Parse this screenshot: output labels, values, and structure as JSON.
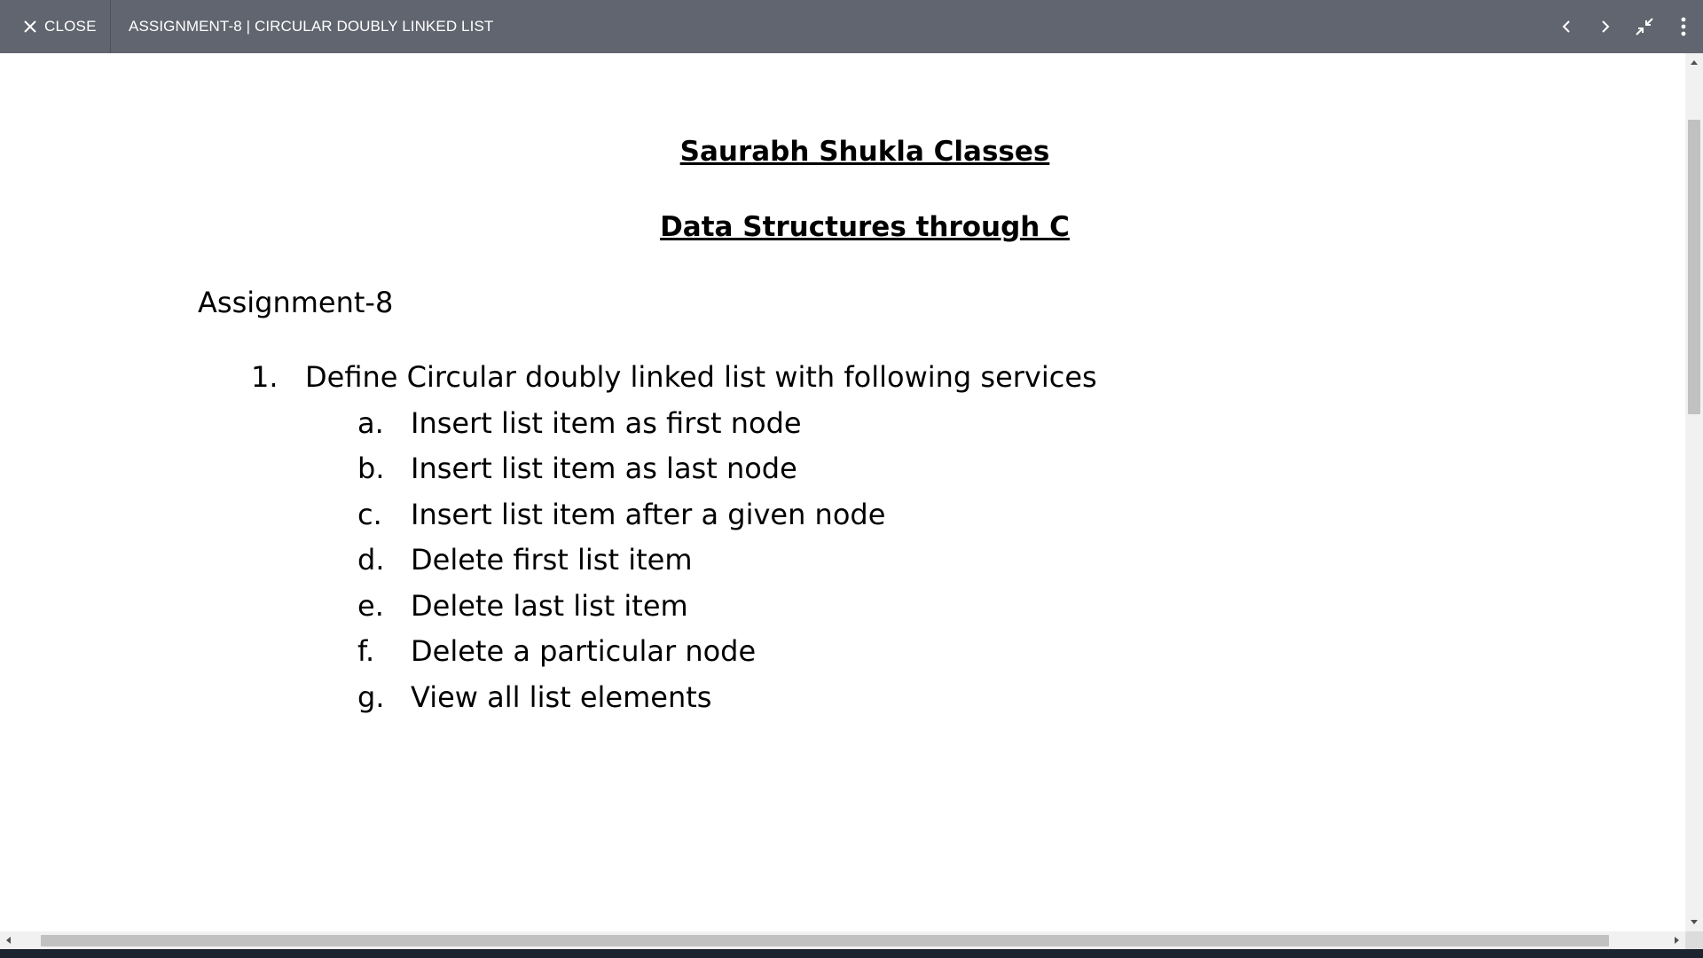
{
  "viewer": {
    "close_label": "CLOSE",
    "title": "ASSIGNMENT-8 | CIRCULAR DOUBLY LINKED LIST",
    "icons": [
      "close-icon",
      "chevron-left-icon",
      "chevron-right-icon",
      "exit-fullscreen-icon",
      "more-vertical-icon"
    ]
  },
  "document": {
    "heading1": "Saurabh Shukla Classes",
    "heading2": "Data Structures through C",
    "assignment": "Assignment-8",
    "question": {
      "number": "1.",
      "text": "Define Circular doubly linked list with following services",
      "items": [
        {
          "letter": "a.",
          "text": "Insert list item as first node"
        },
        {
          "letter": "b.",
          "text": "Insert list item as last node"
        },
        {
          "letter": "c.",
          "text": "Insert list item after a given node"
        },
        {
          "letter": "d.",
          "text": "Delete first list item"
        },
        {
          "letter": "e.",
          "text": "Delete last list item"
        },
        {
          "letter": "f.",
          "text": "Delete a particular node"
        },
        {
          "letter": "g.",
          "text": "View all list elements"
        }
      ]
    }
  },
  "colors": {
    "topbar": "#61656f",
    "topbar_text": "#ffffff",
    "page": "#ffffff",
    "scrollbar_track": "#f1f1f1",
    "scrollbar_thumb": "#c1c1c1"
  }
}
